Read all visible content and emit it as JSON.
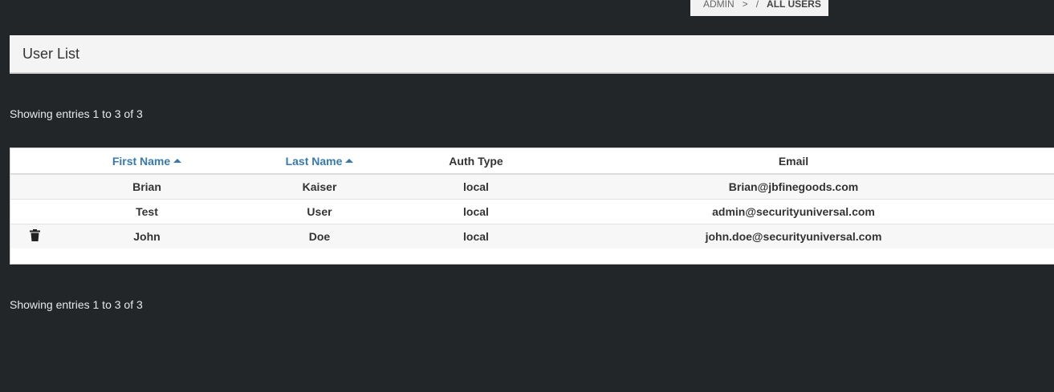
{
  "breadcrumb": {
    "admin": "ADMIN",
    "separator1": ">",
    "separator2": "/",
    "current": "ALL USERS"
  },
  "panel": {
    "title": "User List"
  },
  "entries_info": {
    "top": "Showing entries 1 to 3 of 3",
    "bottom": "Showing entries 1 to 3 of 3"
  },
  "table": {
    "columns": {
      "first_name": "First Name",
      "last_name": "Last Name",
      "auth_type": "Auth Type",
      "email": "Email"
    },
    "sorted_columns": [
      "first_name",
      "last_name"
    ],
    "rows": [
      {
        "first_name": "Brian",
        "last_name": "Kaiser",
        "auth_type": "local",
        "email": "Brian@jbfinegoods.com",
        "has_delete": false
      },
      {
        "first_name": "Test",
        "last_name": "User",
        "auth_type": "local",
        "email": "admin@securityuniversal.com",
        "has_delete": false
      },
      {
        "first_name": "John",
        "last_name": "Doe",
        "auth_type": "local",
        "email": "john.doe@securityuniversal.com",
        "has_delete": true
      }
    ]
  },
  "icons": {
    "sort": "caret-up-icon",
    "delete": "trash-icon"
  },
  "colors": {
    "background": "#222629",
    "link": "#337ab7",
    "panel": "#f4f4f4"
  }
}
